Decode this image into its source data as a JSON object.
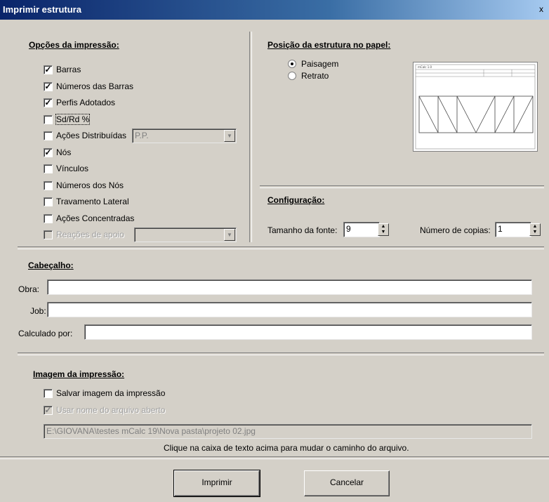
{
  "window": {
    "title": "Imprimir estrutura",
    "close_label": "x"
  },
  "print_options": {
    "title": "Opções da impressão:",
    "items": [
      {
        "label": "Barras",
        "checked": true
      },
      {
        "label": "Números das Barras",
        "checked": true
      },
      {
        "label": "Perfis Adotados",
        "checked": true
      },
      {
        "label": "Sd/Rd %",
        "checked": false
      },
      {
        "label": "Ações Distribuídas",
        "checked": false,
        "select_value": "P.P."
      },
      {
        "label": "Nós",
        "checked": true
      },
      {
        "label": "Vínculos",
        "checked": false
      },
      {
        "label": "Números dos Nós",
        "checked": false
      },
      {
        "label": "Travamento Lateral",
        "checked": false
      },
      {
        "label": "Ações Concentradas",
        "checked": false
      },
      {
        "label": "Reações de apoio",
        "checked": false,
        "disabled": true,
        "select_value": ""
      }
    ]
  },
  "position": {
    "title": "Posição da estrutura no papel:",
    "options": [
      {
        "label": "Paisagem",
        "selected": true
      },
      {
        "label": "Retrato",
        "selected": false
      }
    ]
  },
  "config": {
    "title": "Configuração:",
    "font_size_label": "Tamanho da fonte:",
    "font_size_value": "9",
    "copies_label": "Número de copias:",
    "copies_value": "1"
  },
  "header": {
    "title": "Cabeçalho:",
    "obra_label": "Obra:",
    "obra_value": "",
    "job_label": "Job:",
    "job_value": "",
    "calc_label": "Calculado por:",
    "calc_value": ""
  },
  "image": {
    "title": "Imagem da impressão:",
    "save_label": "Salvar imagem da impressão",
    "save_checked": false,
    "use_name_label": "Usar nome do arquivo aberto",
    "use_name_checked": true,
    "path_value": "E:\\GIOVANA\\testes mCalc 19\\Nova pasta\\projeto 02.jpg",
    "hint": "Clique na caixa de texto acima para mudar o caminho do arquivo."
  },
  "buttons": {
    "print": "Imprimir",
    "cancel": "Cancelar"
  },
  "preview": {
    "header_text": "mCalc 1.0"
  }
}
